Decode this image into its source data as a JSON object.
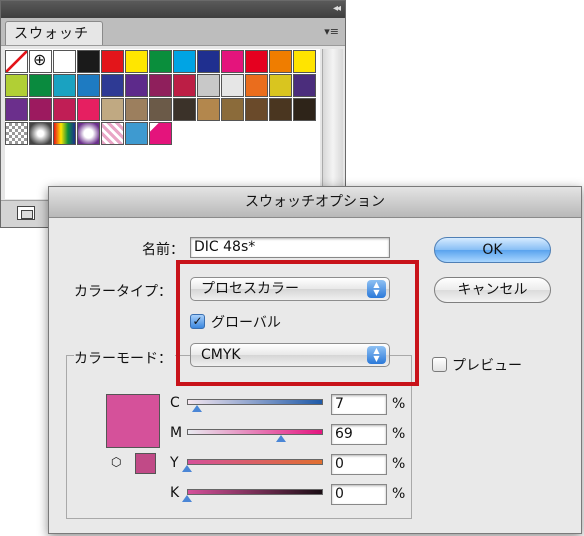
{
  "panel": {
    "tab_label": "スウォッチ",
    "collapse_glyph": "◂◂",
    "menu_glyph": "▾≡",
    "swatch_rows": [
      [
        "none",
        "registration",
        "#ffffff",
        "#1a1a1a",
        "#e3151a",
        "#ffe600",
        "#0a8e3c",
        "#00a4e4",
        "#1f2f8f",
        "#e4147c",
        "#e5001f",
        "#ef7d00",
        "#ffe400"
      ],
      [
        "#b1cf35",
        "#0a8a3e",
        "#1aa2c1",
        "#1e7bc2",
        "#2e3a94",
        "#5d2a8b",
        "#8f1f5c",
        "#bc1e45",
        "#c8c8c8",
        "#e6e6e6",
        "#ea6d1d",
        "#d9c51f",
        "#4b2d7c"
      ],
      [
        "#6b2f8c",
        "#9c1a5f",
        "#c01e55",
        "#e61f61",
        "#c0a982",
        "#9c7f5e",
        "#6b5a48",
        "#3b3229",
        "#b3874d",
        "#8b6b3a",
        "#6a4a2a",
        "#4a3620",
        "#2e2419"
      ],
      [
        "grad-bw",
        "grad-radial",
        "grad-rainbow",
        "grad-purple",
        "pattern-pink",
        "#3e9ad0",
        "pink-folded"
      ]
    ]
  },
  "dialog": {
    "title": "スウォッチオプション",
    "name_label": "名前：",
    "name_value": "DIC 48s*",
    "color_type_label": "カラータイプ：",
    "color_type_value": "プロセスカラー",
    "global_label": "グローバル",
    "global_checked": true,
    "color_mode_label": "カラーモード：",
    "color_mode_value": "CMYK",
    "ok_label": "OK",
    "cancel_label": "キャンセル",
    "preview_label": "プレビュー",
    "preview_checked": false,
    "swatch_color": "#d5519a",
    "gamut_color": "#c14a87",
    "highlight_color": "#c8121a",
    "percent_sign": "%",
    "channels": [
      {
        "label": "C",
        "value": "7",
        "level": 0.07,
        "gradient": [
          "#f4e6ef",
          "#1f5aa8"
        ]
      },
      {
        "label": "M",
        "value": "69",
        "level": 0.69,
        "gradient": [
          "#e8eaf0",
          "#e4157f"
        ]
      },
      {
        "label": "Y",
        "value": "0",
        "level": 0.0,
        "gradient": [
          "#d5519a",
          "#e06f30"
        ]
      },
      {
        "label": "K",
        "value": "0",
        "level": 0.0,
        "gradient": [
          "#d5519a",
          "#1a0d14"
        ]
      }
    ]
  }
}
